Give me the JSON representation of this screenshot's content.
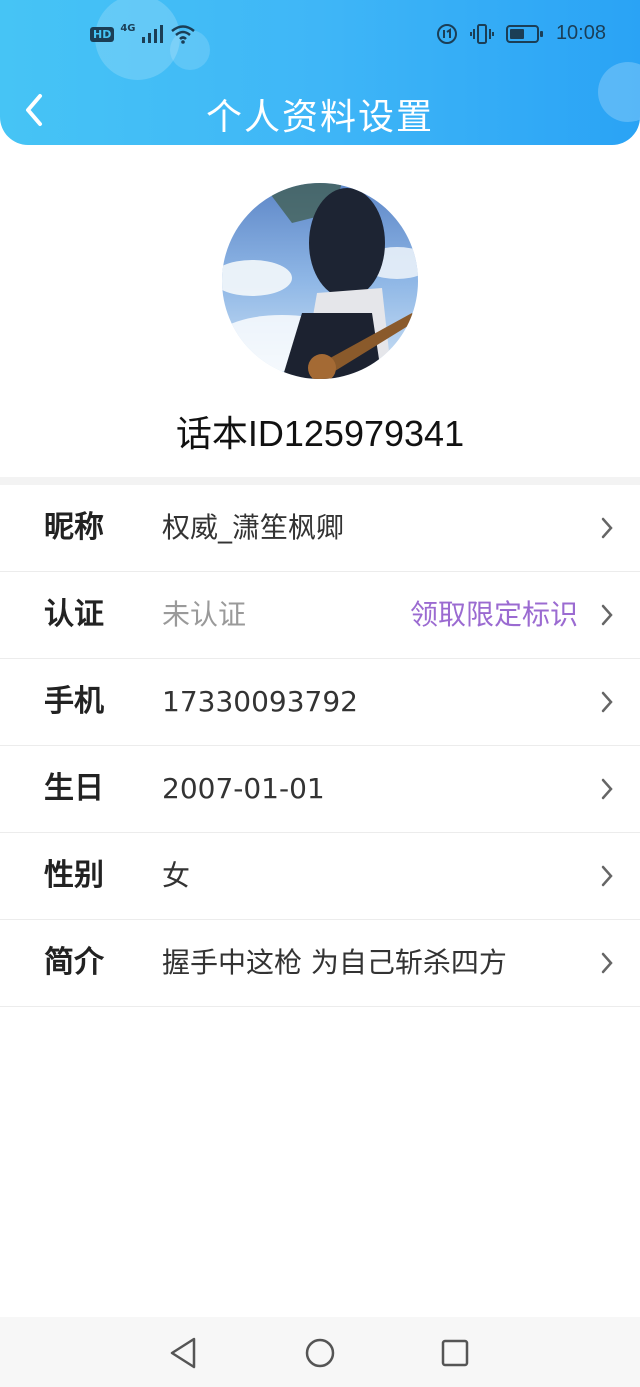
{
  "status_bar": {
    "network_badge": "HD",
    "network_type": "4G",
    "time": "10:08"
  },
  "header": {
    "title": "个人资料设置",
    "back_icon": "chevron-left-icon",
    "gradient_colors": [
      "#46c4f5",
      "#2aa3f5"
    ]
  },
  "profile": {
    "user_id_text": "话本ID125979341"
  },
  "rows": [
    {
      "label": "昵称",
      "value": "权威_潇笙枫卿",
      "value_muted": false,
      "extra": ""
    },
    {
      "label": "认证",
      "value": "未认证",
      "value_muted": true,
      "extra": "领取限定标识"
    },
    {
      "label": "手机",
      "value": "17330093792",
      "value_muted": false,
      "extra": ""
    },
    {
      "label": "生日",
      "value": "2007-01-01",
      "value_muted": false,
      "extra": ""
    },
    {
      "label": "性别",
      "value": "女",
      "value_muted": false,
      "extra": ""
    },
    {
      "label": "简介",
      "value": "握手中这枪 为自己斩杀四方",
      "value_muted": false,
      "extra": ""
    }
  ],
  "colors": {
    "accent_purple": "#9b6bd1",
    "muted_text": "#9a9a9a"
  },
  "navbar": {
    "icons": [
      "back-triangle-icon",
      "home-circle-icon",
      "recents-square-icon"
    ]
  }
}
